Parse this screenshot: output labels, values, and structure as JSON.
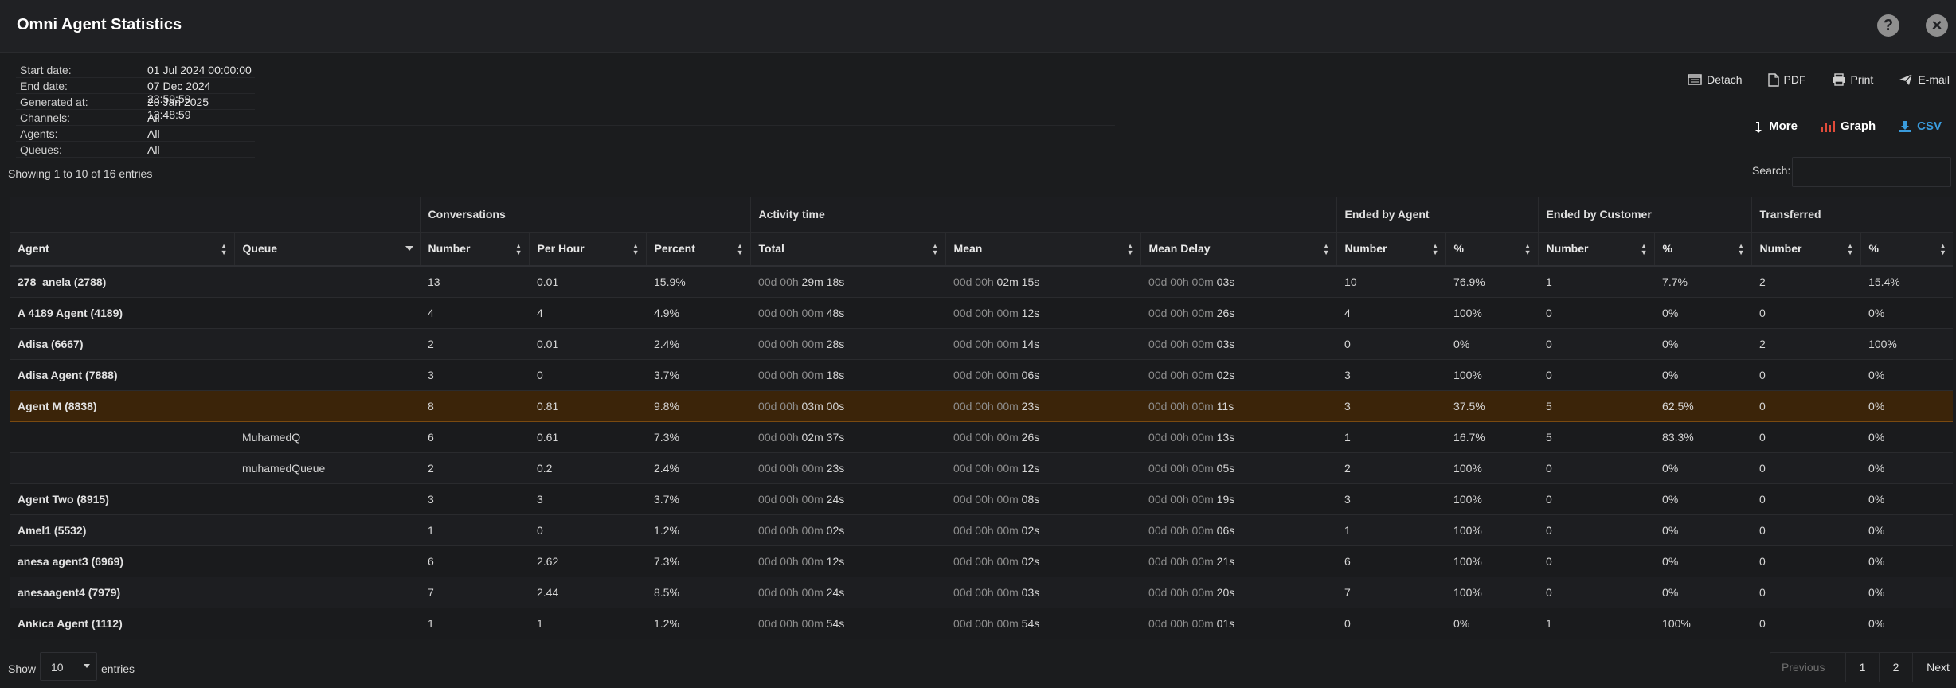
{
  "window": {
    "title": "Omni Agent Statistics"
  },
  "meta": [
    {
      "label": "Start date:",
      "value": "01 Jul 2024 00:00:00"
    },
    {
      "label": "End date:",
      "value": "07 Dec 2024 23:59:59"
    },
    {
      "label": "Generated at:",
      "value": "20 Jan 2025 13:48:59"
    },
    {
      "label": "Channels:",
      "value": "All"
    },
    {
      "label": "Agents:",
      "value": "All"
    },
    {
      "label": "Queues:",
      "value": "All"
    }
  ],
  "actions": {
    "detach": "Detach",
    "pdf": "PDF",
    "print": "Print",
    "email": "E-mail",
    "more": "More",
    "graph": "Graph",
    "csv": "CSV"
  },
  "colors": {
    "highlight_row": "#3b2409",
    "csv_accent": "#3a9bdc",
    "graph_accent": "#e04b3a"
  },
  "table_info": {
    "showing": "Showing 1 to 10 of 16 entries",
    "search_label": "Search:"
  },
  "groups": {
    "conversations": "Conversations",
    "activity_time": "Activity time",
    "ended_by_agent": "Ended by Agent",
    "ended_by_customer": "Ended by Customer",
    "transferred": "Transferred"
  },
  "columns": {
    "agent": "Agent",
    "queue": "Queue",
    "number": "Number",
    "per_hour": "Per Hour",
    "percent": "Percent",
    "total": "Total",
    "mean": "Mean",
    "mean_delay": "Mean Delay",
    "eba_number": "Number",
    "eba_pct": "%",
    "ebc_number": "Number",
    "ebc_pct": "%",
    "tr_number": "Number",
    "tr_pct": "%"
  },
  "rows": [
    {
      "agent": "278_anela (2788)",
      "queue": "",
      "number": "13",
      "per_hour": "0.01",
      "percent": "15.9%",
      "total_dim": "00d 00h ",
      "total": "29m 18s",
      "mean_dim": "00d 00h ",
      "mean": "02m 15s",
      "delay_dim": "00d 00h 00m ",
      "delay": "03s",
      "eba_n": "10",
      "eba_p": "76.9%",
      "ebc_n": "1",
      "ebc_p": "7.7%",
      "tr_n": "2",
      "tr_p": "15.4%"
    },
    {
      "agent": "A 4189 Agent (4189)",
      "queue": "",
      "number": "4",
      "per_hour": "4",
      "percent": "4.9%",
      "total_dim": "00d 00h 00m ",
      "total": "48s",
      "mean_dim": "00d 00h 00m ",
      "mean": "12s",
      "delay_dim": "00d 00h 00m ",
      "delay": "26s",
      "eba_n": "4",
      "eba_p": "100%",
      "ebc_n": "0",
      "ebc_p": "0%",
      "tr_n": "0",
      "tr_p": "0%"
    },
    {
      "agent": "Adisa (6667)",
      "queue": "",
      "number": "2",
      "per_hour": "0.01",
      "percent": "2.4%",
      "total_dim": "00d 00h 00m ",
      "total": "28s",
      "mean_dim": "00d 00h 00m ",
      "mean": "14s",
      "delay_dim": "00d 00h 00m ",
      "delay": "03s",
      "eba_n": "0",
      "eba_p": "0%",
      "ebc_n": "0",
      "ebc_p": "0%",
      "tr_n": "2",
      "tr_p": "100%"
    },
    {
      "agent": "Adisa Agent (7888)",
      "queue": "",
      "number": "3",
      "per_hour": "0",
      "percent": "3.7%",
      "total_dim": "00d 00h 00m ",
      "total": "18s",
      "mean_dim": "00d 00h 00m ",
      "mean": "06s",
      "delay_dim": "00d 00h 00m ",
      "delay": "02s",
      "eba_n": "3",
      "eba_p": "100%",
      "ebc_n": "0",
      "ebc_p": "0%",
      "tr_n": "0",
      "tr_p": "0%"
    },
    {
      "agent": "Agent M (8838)",
      "queue": "",
      "number": "8",
      "per_hour": "0.81",
      "percent": "9.8%",
      "total_dim": "00d 00h ",
      "total": "03m 00s",
      "mean_dim": "00d 00h 00m ",
      "mean": "23s",
      "delay_dim": "00d 00h 00m ",
      "delay": "11s",
      "eba_n": "3",
      "eba_p": "37.5%",
      "ebc_n": "5",
      "ebc_p": "62.5%",
      "tr_n": "0",
      "tr_p": "0%",
      "highlight": true
    },
    {
      "agent": "",
      "queue": "MuhamedQ",
      "number": "6",
      "per_hour": "0.61",
      "percent": "7.3%",
      "total_dim": "00d 00h ",
      "total": "02m 37s",
      "mean_dim": "00d 00h 00m ",
      "mean": "26s",
      "delay_dim": "00d 00h 00m ",
      "delay": "13s",
      "eba_n": "1",
      "eba_p": "16.7%",
      "ebc_n": "5",
      "ebc_p": "83.3%",
      "tr_n": "0",
      "tr_p": "0%"
    },
    {
      "agent": "",
      "queue": "muhamedQueue",
      "number": "2",
      "per_hour": "0.2",
      "percent": "2.4%",
      "total_dim": "00d 00h 00m ",
      "total": "23s",
      "mean_dim": "00d 00h 00m ",
      "mean": "12s",
      "delay_dim": "00d 00h 00m ",
      "delay": "05s",
      "eba_n": "2",
      "eba_p": "100%",
      "ebc_n": "0",
      "ebc_p": "0%",
      "tr_n": "0",
      "tr_p": "0%"
    },
    {
      "agent": "Agent Two (8915)",
      "queue": "",
      "number": "3",
      "per_hour": "3",
      "percent": "3.7%",
      "total_dim": "00d 00h 00m ",
      "total": "24s",
      "mean_dim": "00d 00h 00m ",
      "mean": "08s",
      "delay_dim": "00d 00h 00m ",
      "delay": "19s",
      "eba_n": "3",
      "eba_p": "100%",
      "ebc_n": "0",
      "ebc_p": "0%",
      "tr_n": "0",
      "tr_p": "0%"
    },
    {
      "agent": "Amel1 (5532)",
      "queue": "",
      "number": "1",
      "per_hour": "0",
      "percent": "1.2%",
      "total_dim": "00d 00h 00m ",
      "total": "02s",
      "mean_dim": "00d 00h 00m ",
      "mean": "02s",
      "delay_dim": "00d 00h 00m ",
      "delay": "06s",
      "eba_n": "1",
      "eba_p": "100%",
      "ebc_n": "0",
      "ebc_p": "0%",
      "tr_n": "0",
      "tr_p": "0%"
    },
    {
      "agent": "anesa agent3 (6969)",
      "queue": "",
      "number": "6",
      "per_hour": "2.62",
      "percent": "7.3%",
      "total_dim": "00d 00h 00m ",
      "total": "12s",
      "mean_dim": "00d 00h 00m ",
      "mean": "02s",
      "delay_dim": "00d 00h 00m ",
      "delay": "21s",
      "eba_n": "6",
      "eba_p": "100%",
      "ebc_n": "0",
      "ebc_p": "0%",
      "tr_n": "0",
      "tr_p": "0%"
    },
    {
      "agent": "anesaagent4 (7979)",
      "queue": "",
      "number": "7",
      "per_hour": "2.44",
      "percent": "8.5%",
      "total_dim": "00d 00h 00m ",
      "total": "24s",
      "mean_dim": "00d 00h 00m ",
      "mean": "03s",
      "delay_dim": "00d 00h 00m ",
      "delay": "20s",
      "eba_n": "7",
      "eba_p": "100%",
      "ebc_n": "0",
      "ebc_p": "0%",
      "tr_n": "0",
      "tr_p": "0%"
    },
    {
      "agent": "Ankica Agent (1112)",
      "queue": "",
      "number": "1",
      "per_hour": "1",
      "percent": "1.2%",
      "total_dim": "00d 00h 00m ",
      "total": "54s",
      "mean_dim": "00d 00h 00m ",
      "mean": "54s",
      "delay_dim": "00d 00h 00m ",
      "delay": "01s",
      "eba_n": "0",
      "eba_p": "0%",
      "ebc_n": "1",
      "ebc_p": "100%",
      "tr_n": "0",
      "tr_p": "0%"
    }
  ],
  "footer": {
    "show": "Show",
    "page_length": "10",
    "entries": "entries"
  },
  "pagination": {
    "previous": "Previous",
    "pages": [
      "1",
      "2"
    ],
    "next": "Next"
  }
}
